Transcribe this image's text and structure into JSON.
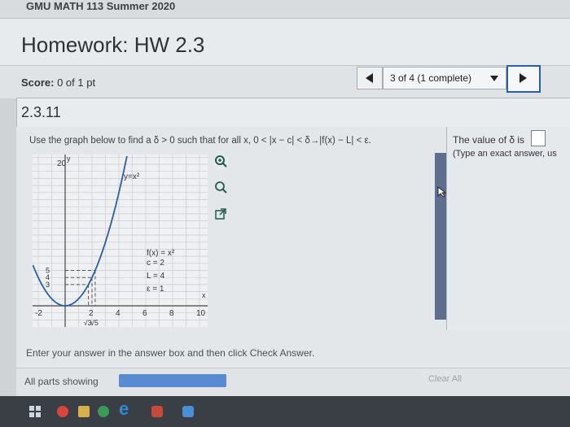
{
  "course": "GMU MATH 113 Summer 2020",
  "homework_title": "Homework: HW 2.3",
  "score": {
    "label": "Score:",
    "value": "0 of 1 pt"
  },
  "nav": {
    "selector_label": "3 of 4 (1 complete)"
  },
  "question_id": "2.3.11",
  "question_text": "Use the graph below to find a δ > 0 such that for all x, 0 < |x − c| < δ→|f(x) − L| < ε.",
  "answer": {
    "prefix": "The value of δ is",
    "value": "",
    "hint": "(Type an exact answer, us"
  },
  "graph": {
    "y_tick_20": "20",
    "curve_label": "y=x²",
    "f_label": "f(x) = x²",
    "c_label": "c = 2",
    "L_label": "L = 4",
    "eps_label": "ε = 1",
    "x_axis": "x",
    "y_axis": "y",
    "x_ticks": [
      "-2",
      "2",
      "4",
      "6",
      "8",
      "10"
    ],
    "y_ticks_small": [
      "5",
      "4",
      "3"
    ],
    "sqrt_labels": [
      "√3",
      "√5"
    ],
    "ref_lines": [
      3,
      4,
      5
    ]
  },
  "instruction": "Enter your answer in the answer box and then click Check Answer.",
  "footer": {
    "parts_label": "All parts showing",
    "clear_label": "Clear All"
  },
  "colors": {
    "accent": "#2a5fa8",
    "progress": "#5a8bd0",
    "scrollbar": "#5d6e8e"
  }
}
